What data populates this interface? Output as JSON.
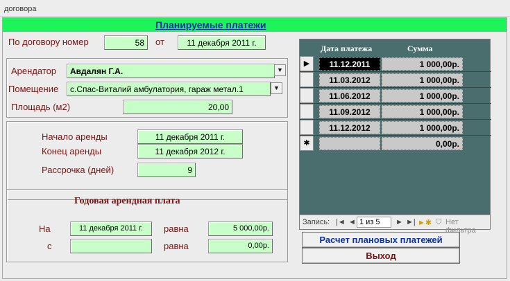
{
  "window": {
    "title": "договора"
  },
  "header": {
    "title": "Планируемые платежи"
  },
  "contract": {
    "label": "По договору номер",
    "number": "58",
    "date_label": "от",
    "date": "11 декабря 2011 г."
  },
  "tenant": {
    "label": "Арендатор",
    "value": "Авдалян Г.А.",
    "premises_label": "Помещение",
    "premises_value": "с.Спас-Виталий амбулатория, гараж метал.1",
    "area_label": "Площадь (м2)",
    "area_value": "20,00"
  },
  "lease": {
    "start_label": "Начало аренды",
    "start_value": "11 декабря 2011 г.",
    "end_label": "Конец аренды",
    "end_value": "11 декабря 2012 г.",
    "installment_label": "Рассрочка (дней)",
    "installment_value": "9"
  },
  "annual": {
    "title": "Годовая арендная плата",
    "on_label": "На",
    "on_date": "11 декабря 2011 г.",
    "eq_label_1": "равна",
    "amount_1": "5 000,00р.",
    "from_label": "с",
    "from_value": "",
    "eq_label_2": "равна",
    "amount_2": "0,00р."
  },
  "grid": {
    "col_date": "Дата  платежа",
    "col_sum": "Сумма",
    "rows": [
      {
        "date": "11.12.2011",
        "sum": "1 000,00р."
      },
      {
        "date": "11.03.2012",
        "sum": "1 000,00р."
      },
      {
        "date": "11.06.2012",
        "sum": "1 000,00р."
      },
      {
        "date": "11.09.2012",
        "sum": "1 000,00р."
      },
      {
        "date": "11.12.2012",
        "sum": "1 000,00р."
      }
    ],
    "new_row": {
      "date": "",
      "sum": "0,00р."
    },
    "current_marker": "▶",
    "new_marker": "✱"
  },
  "navigation": {
    "label": "Запись:",
    "position": "1 из 5",
    "filter_label": "Нет фильтра"
  },
  "buttons": {
    "calc": "Расчет плановых платежей",
    "exit": "Выход"
  },
  "colors": {
    "accent_green": "#1ff35a",
    "field_green": "#c8ffc8",
    "label_red": "#7b1212",
    "grid_bg": "#4a6e6d",
    "title_blue": "#0a2fa8"
  }
}
